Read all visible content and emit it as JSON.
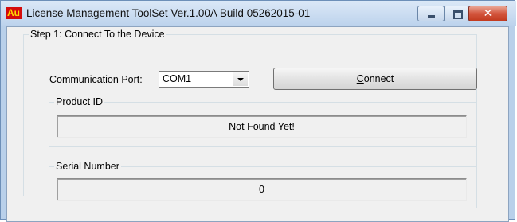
{
  "window": {
    "app_icon_text": "Au",
    "title": "License Management ToolSet Ver.1.00A Build 05262015-01",
    "close_glyph": "✕"
  },
  "step1": {
    "legend": "Step 1: Connect To the Device",
    "port_label": "Communication Port:",
    "port_value": "COM1",
    "connect_button_prefix": "C",
    "connect_button_rest": "onnect"
  },
  "product": {
    "legend": "Product ID",
    "value": "Not Found Yet!"
  },
  "serial": {
    "legend": "Serial Number",
    "value": "0"
  },
  "colors": {
    "title_accent": "#d40c0c",
    "close_button": "#c23a1f"
  }
}
